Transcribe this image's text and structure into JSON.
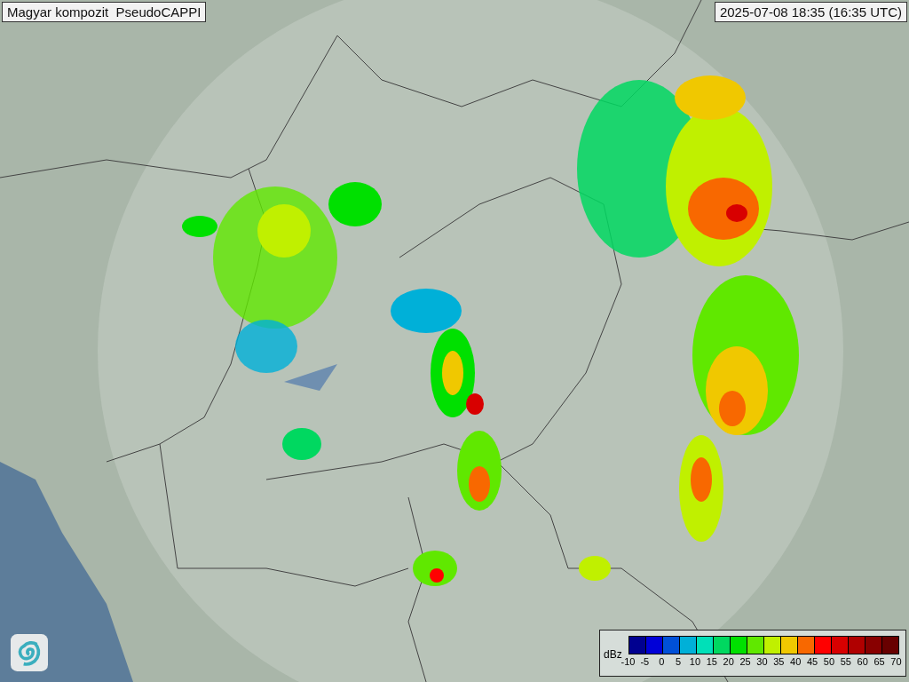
{
  "title": "Magyar kompozit  PseudoCAPPI",
  "timestamp": "2025-07-08 18:35 (16:35 UTC)",
  "legend": {
    "unit": "dBz",
    "bins": [
      {
        "color": "#000090"
      },
      {
        "color": "#0000d8"
      },
      {
        "color": "#0050d8"
      },
      {
        "color": "#00b0d8"
      },
      {
        "color": "#00e0b8"
      },
      {
        "color": "#00d860"
      },
      {
        "color": "#00e000"
      },
      {
        "color": "#60e800"
      },
      {
        "color": "#c0f000"
      },
      {
        "color": "#f0c800"
      },
      {
        "color": "#f86800"
      },
      {
        "color": "#ff0000"
      },
      {
        "color": "#d80000"
      },
      {
        "color": "#b00000"
      },
      {
        "color": "#880000"
      },
      {
        "color": "#680000"
      }
    ],
    "ticks": [
      "-10",
      "-5",
      "0",
      "5",
      "10",
      "15",
      "20",
      "25",
      "30",
      "35",
      "40",
      "45",
      "50",
      "55",
      "60",
      "65",
      "70"
    ]
  }
}
